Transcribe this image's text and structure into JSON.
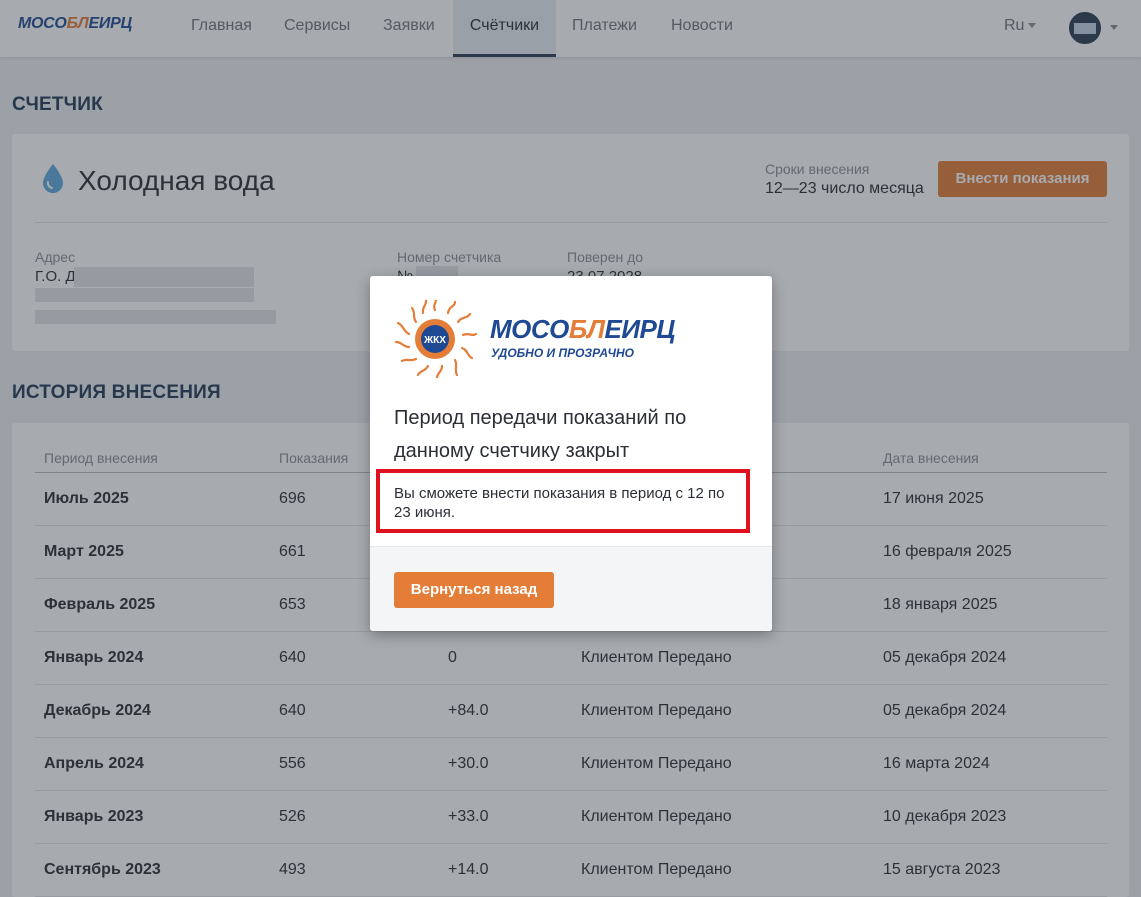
{
  "nav": {
    "logo_part1": "МОСО",
    "logo_part2": "БЛ",
    "logo_part3": "ЕИРЦ",
    "items": [
      "Главная",
      "Сервисы",
      "Заявки",
      "Счётчики",
      "Платежи",
      "Новости"
    ],
    "active_index": 3,
    "language": "Ru"
  },
  "meter_section": {
    "heading": "СЧЕТЧИК",
    "icon": "water-drop-icon",
    "title": "Холодная вода",
    "deadline_label": "Сроки внесения",
    "deadline_value": "12—23 число месяца",
    "submit_button": "Внести показания",
    "address_label": "Адрес",
    "address_value": "Г.О. Д",
    "number_label": "Номер счетчика",
    "number_value": "№",
    "verified_label": "Поверен до",
    "verified_value": "23.07.2028"
  },
  "history": {
    "heading": "ИСТОРИЯ ВНЕСЕНИЯ",
    "columns": [
      "Период внесения",
      "Показания",
      "",
      "",
      "Дата внесения"
    ],
    "rows": [
      {
        "period": "Июль 2025",
        "reading": "696",
        "diff": "",
        "source": "",
        "date": "17 июня 2025"
      },
      {
        "period": "Март 2025",
        "reading": "661",
        "diff": "",
        "source": "",
        "date": "16 февраля 2025"
      },
      {
        "period": "Февраль 2025",
        "reading": "653",
        "diff": "",
        "source": "",
        "date": "18 января 2025"
      },
      {
        "period": "Январь 2024",
        "reading": "640",
        "diff": "0",
        "source": "Клиентом Передано",
        "date": "05 декабря 2024"
      },
      {
        "period": "Декабрь 2024",
        "reading": "640",
        "diff": "+84.0",
        "source": "Клиентом Передано",
        "date": "05 декабря 2024"
      },
      {
        "period": "Апрель 2024",
        "reading": "556",
        "diff": "+30.0",
        "source": "Клиентом Передано",
        "date": "16 марта 2024"
      },
      {
        "period": "Январь 2023",
        "reading": "526",
        "diff": "+33.0",
        "source": "Клиентом Передано",
        "date": "10 декабря 2023"
      },
      {
        "period": "Сентябрь 2023",
        "reading": "493",
        "diff": "+14.0",
        "source": "Клиентом Передано",
        "date": "15 августа 2023"
      }
    ]
  },
  "modal": {
    "logo_part1": "МОСО",
    "logo_part2": "БЛ",
    "logo_part3": "ЕИРЦ",
    "logo_badge": "ЖКХ",
    "tagline": "УДОБНО И ПРОЗРАЧНО",
    "title": "Период передачи показаний по данному счетчику закрыт",
    "note": "Вы сможете внести показания в период с 12 по 23 июня.",
    "back_button": "Вернуться назад"
  },
  "colors": {
    "brand_blue": "#1f4a93",
    "brand_orange": "#e47d37",
    "highlight_red": "#e0111f"
  }
}
